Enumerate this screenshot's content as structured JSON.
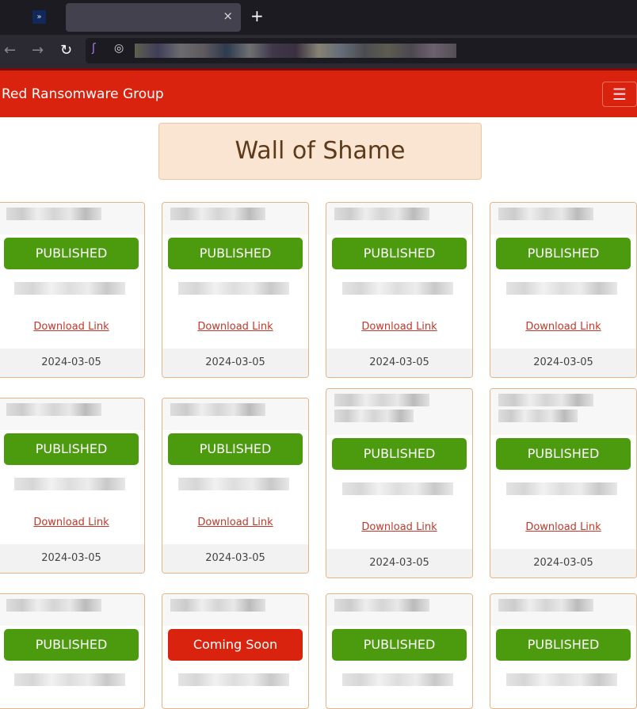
{
  "browser": {
    "close": "×",
    "new_tab": "+",
    "back": "←",
    "forward": "→",
    "reload": "↻"
  },
  "site": {
    "brand": "Red Ransomware Group",
    "menu_icon": "hamburger-icon",
    "title": "Wall of Shame"
  },
  "colors": {
    "header": "#d9230f",
    "published": "#4c9b0f",
    "coming_soon": "#d9230f"
  },
  "cards": [
    {
      "status": "PUBLISHED",
      "link": "Download Link",
      "date": "2024-03-05"
    },
    {
      "status": "PUBLISHED",
      "link": "Download Link",
      "date": "2024-03-05"
    },
    {
      "status": "PUBLISHED",
      "link": "Download Link",
      "date": "2024-03-05"
    },
    {
      "status": "PUBLISHED",
      "link": "Download Link",
      "date": "2024-03-05"
    },
    {
      "status": "PUBLISHED",
      "link": "Download Link",
      "date": "2024-03-05"
    },
    {
      "status": "PUBLISHED",
      "link": "Download Link",
      "date": "2024-03-05"
    },
    {
      "status": "PUBLISHED",
      "link": "Download Link",
      "date": "2024-03-05"
    },
    {
      "status": "PUBLISHED",
      "link": "Download Link",
      "date": "2024-03-05"
    },
    {
      "status": "PUBLISHED"
    },
    {
      "status": "Coming Soon"
    },
    {
      "status": "PUBLISHED"
    },
    {
      "status": "PUBLISHED"
    }
  ]
}
